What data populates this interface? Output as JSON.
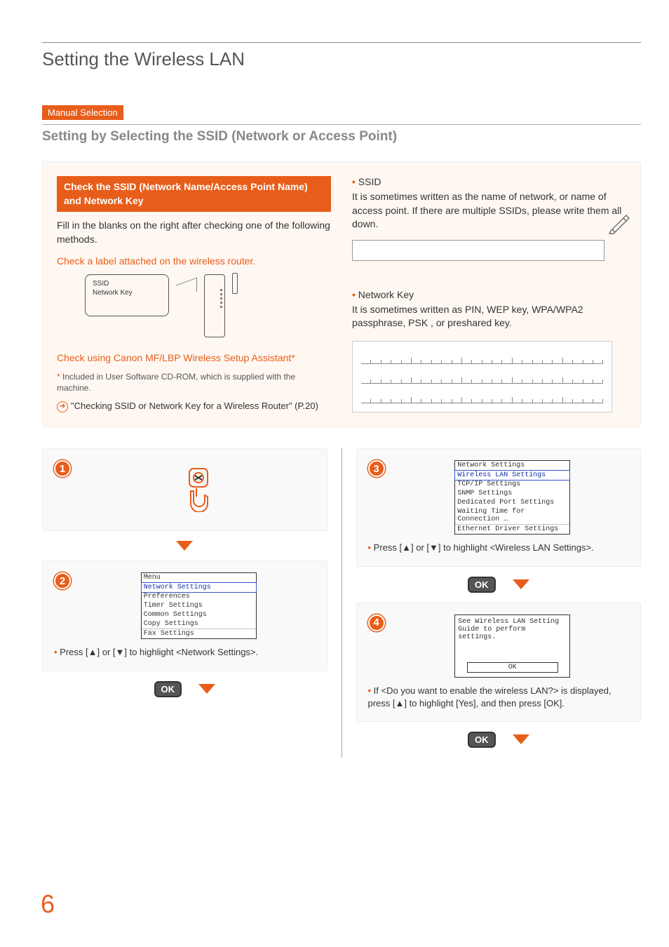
{
  "title": "Setting the Wireless LAN",
  "tag": "Manual Selection",
  "subtitle": "Setting by Selecting the SSID (Network or Access Point)",
  "info": {
    "head1": "Check the SSID (Network Name/Access Point Name) and Network Key",
    "body1": "Fill in the blanks on the right after checking one of the following methods.",
    "check_label": "Check a label attached on the wireless router.",
    "router_label_l1": "SSID",
    "router_label_l2": "Network Key",
    "assistant": "Check using Canon MF/LBP Wireless Setup Assistant*",
    "footnote": "Included in User Software CD-ROM, which is supplied with the machine.",
    "ref": "\"Checking SSID or Network Key for a Wireless Router\" (P.20)",
    "ssid_h": "SSID",
    "ssid_b": "It is sometimes written as the name of network, or name of access point. If there are multiple SSIDs, please write them all down.",
    "nk_h": "Network Key",
    "nk_b": "It is sometimes written as PIN, WEP key, WPA/WPA2 passphrase, PSK , or preshared key."
  },
  "steps": {
    "s1": "1",
    "s2": "2",
    "s3": "3",
    "s4": "4",
    "menu2": {
      "title": "Menu",
      "items": [
        "Network Settings",
        "Preferences",
        "Timer Settings",
        "Common Settings",
        "Copy Settings",
        "Fax Settings"
      ]
    },
    "note2": "Press [▲] or [▼] to highlight <Network Settings>.",
    "menu3": {
      "title": "Network Settings",
      "items": [
        "Wireless LAN Settings",
        "TCP/IP Settings",
        "SNMP Settings",
        "Dedicated Port Settings",
        "Waiting Time for Connection …",
        "Ethernet Driver Settings"
      ]
    },
    "note3": "Press [▲] or [▼] to highlight <Wireless LAN Settings>.",
    "confirm4_l1": "See Wireless LAN Setting",
    "confirm4_l2": "Guide to perform settings.",
    "confirm4_ok": "OK",
    "note4": "If <Do you want to enable the wireless LAN?> is displayed, press [▲] to highlight [Yes], and then press [OK].",
    "ok": "OK"
  },
  "page": "6"
}
